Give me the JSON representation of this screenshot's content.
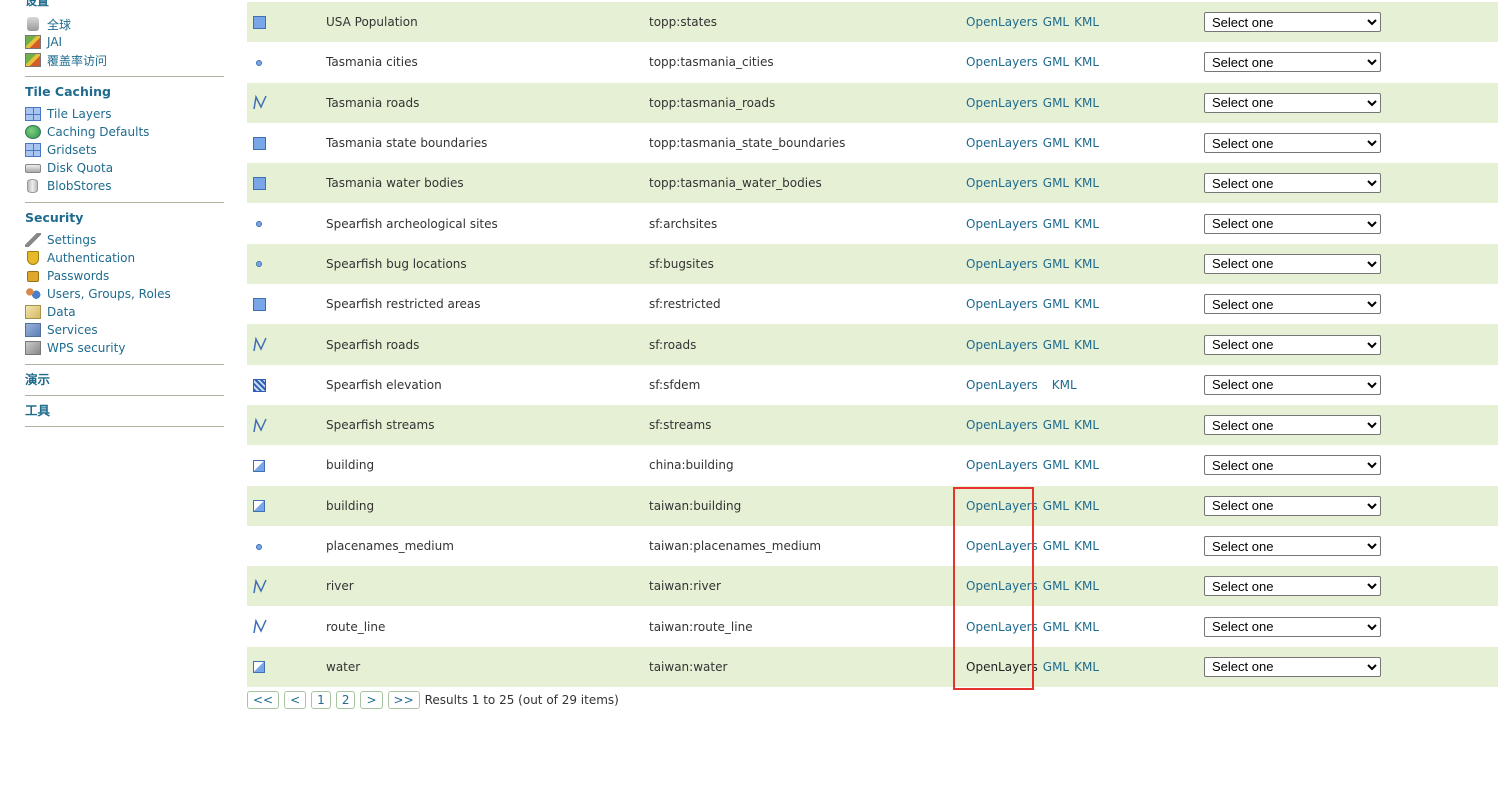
{
  "sidebar": {
    "top_title_cut": "设置",
    "top_items": [
      {
        "label": "全球",
        "icon": "disk-icon"
      },
      {
        "label": "JAI",
        "icon": "image-icon"
      },
      {
        "label": "覆盖率访问",
        "icon": "image-icon"
      }
    ],
    "sections": [
      {
        "title": "Tile Caching",
        "items": [
          {
            "label": "Tile Layers",
            "icon": "grid-icon"
          },
          {
            "label": "Caching Defaults",
            "icon": "globe-icon"
          },
          {
            "label": "Gridsets",
            "icon": "grid-icon"
          },
          {
            "label": "Disk Quota",
            "icon": "drive-icon"
          },
          {
            "label": "BlobStores",
            "icon": "cylinder-icon"
          }
        ]
      },
      {
        "title": "Security",
        "items": [
          {
            "label": "Settings",
            "icon": "wrench-icon"
          },
          {
            "label": "Authentication",
            "icon": "shield-icon"
          },
          {
            "label": "Passwords",
            "icon": "lock-icon"
          },
          {
            "label": "Users, Groups, Roles",
            "icon": "users-icon"
          },
          {
            "label": "Data",
            "icon": "data-icon"
          },
          {
            "label": "Services",
            "icon": "services-icon"
          },
          {
            "label": "WPS security",
            "icon": "wps-icon"
          }
        ]
      }
    ],
    "simple_sections": [
      "演示",
      "工具"
    ]
  },
  "layers": {
    "select_placeholder": "Select one",
    "link_openlayers": "OpenLayers",
    "link_gml": "GML",
    "link_kml": "KML",
    "rows": [
      {
        "type": "polygon",
        "title": "USA Population",
        "name": "topp:states",
        "gml": true
      },
      {
        "type": "point",
        "title": "Tasmania cities",
        "name": "topp:tasmania_cities",
        "gml": true
      },
      {
        "type": "line",
        "title": "Tasmania roads",
        "name": "topp:tasmania_roads",
        "gml": true
      },
      {
        "type": "polygon",
        "title": "Tasmania state boundaries",
        "name": "topp:tasmania_state_boundaries",
        "gml": true
      },
      {
        "type": "polygon",
        "title": "Tasmania water bodies",
        "name": "topp:tasmania_water_bodies",
        "gml": true
      },
      {
        "type": "point",
        "title": "Spearfish archeological sites",
        "name": "sf:archsites",
        "gml": true
      },
      {
        "type": "point",
        "title": "Spearfish bug locations",
        "name": "sf:bugsites",
        "gml": true
      },
      {
        "type": "polygon",
        "title": "Spearfish restricted areas",
        "name": "sf:restricted",
        "gml": true
      },
      {
        "type": "line",
        "title": "Spearfish roads",
        "name": "sf:roads",
        "gml": true
      },
      {
        "type": "raster",
        "title": "Spearfish elevation",
        "name": "sf:sfdem",
        "gml": false
      },
      {
        "type": "line",
        "title": "Spearfish streams",
        "name": "sf:streams",
        "gml": true
      },
      {
        "type": "mixed",
        "title": "building",
        "name": "china:building",
        "gml": true
      },
      {
        "type": "mixed",
        "title": "building",
        "name": "taiwan:building",
        "gml": true
      },
      {
        "type": "point",
        "title": "placenames_medium",
        "name": "taiwan:placenames_medium",
        "gml": true
      },
      {
        "type": "line",
        "title": "river",
        "name": "taiwan:river",
        "gml": true
      },
      {
        "type": "line",
        "title": "route_line",
        "name": "taiwan:route_line",
        "gml": true
      },
      {
        "type": "mixed",
        "title": "water",
        "name": "taiwan:water",
        "gml": true,
        "hovered": true
      }
    ]
  },
  "pager": {
    "buttons": [
      "<<",
      "<",
      "1",
      "2",
      ">",
      ">>"
    ],
    "summary": "Results 1 to 25 (out of 29 items)"
  },
  "colors": {
    "link": "#1f6b8e",
    "row_alt": "#e6f0d4",
    "highlight": "#e8322e"
  }
}
